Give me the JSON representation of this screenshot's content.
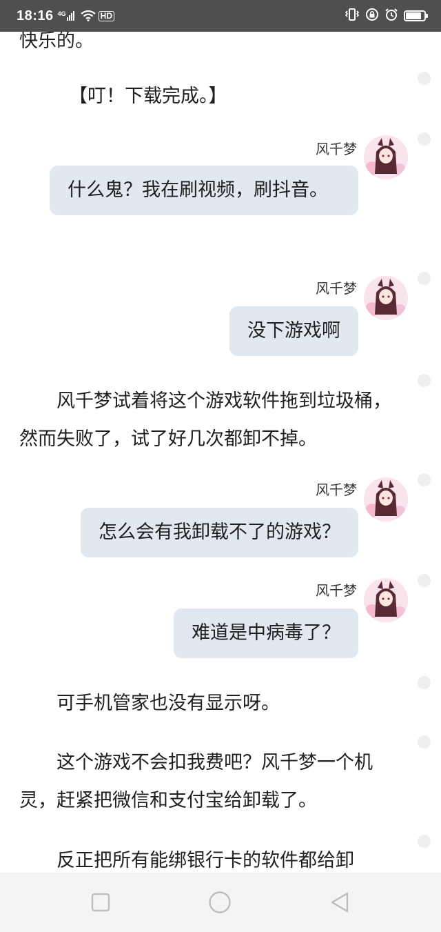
{
  "status_bar": {
    "time": "18:16",
    "network": "4G",
    "hd": "HD",
    "battery_level": 0.85
  },
  "story": {
    "top_partial": "快乐的。",
    "download_notice": "【叮！下载完成。】",
    "para_1": "风千梦试着将这个游戏软件拖到垃圾桶，然而失败了，试了好几次都卸不掉。",
    "para_2": "可手机管家也没有显示呀。",
    "para_3": "这个游戏不会扣我费吧？风千梦一个机灵，赶紧把微信和支付宝给卸载了。",
    "para_4": "反正把所有能绑银行卡的软件都给卸"
  },
  "dialogues": [
    {
      "speaker": "风千梦",
      "text": "什么鬼？我在刷视频，刷抖音。"
    },
    {
      "speaker": "风千梦",
      "text": "没下游戏啊"
    },
    {
      "speaker": "风千梦",
      "text": "怎么会有我卸载不了的游戏？"
    },
    {
      "speaker": "风千梦",
      "text": "难道是中病毒了？"
    }
  ],
  "colors": {
    "status_bar_bg": "#4f4f4f",
    "bubble_bg": "#e1e8f0",
    "comment_dot": "#eeeeee",
    "nav_bar_bg": "#f4f4f4"
  },
  "nav": {
    "recent_icon": "square-icon",
    "home_icon": "circle-icon",
    "back_icon": "triangle-back-icon"
  }
}
